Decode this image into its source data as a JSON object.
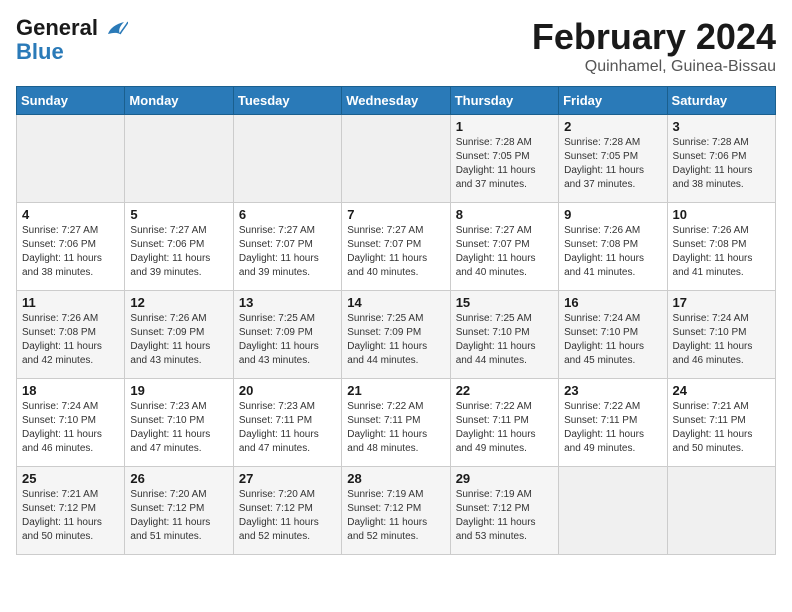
{
  "logo": {
    "line1": "General",
    "line2": "Blue"
  },
  "title": "February 2024",
  "subtitle": "Quinhamel, Guinea-Bissau",
  "weekdays": [
    "Sunday",
    "Monday",
    "Tuesday",
    "Wednesday",
    "Thursday",
    "Friday",
    "Saturday"
  ],
  "weeks": [
    [
      {
        "day": "",
        "info": ""
      },
      {
        "day": "",
        "info": ""
      },
      {
        "day": "",
        "info": ""
      },
      {
        "day": "",
        "info": ""
      },
      {
        "day": "1",
        "info": "Sunrise: 7:28 AM\nSunset: 7:05 PM\nDaylight: 11 hours and 37 minutes."
      },
      {
        "day": "2",
        "info": "Sunrise: 7:28 AM\nSunset: 7:05 PM\nDaylight: 11 hours and 37 minutes."
      },
      {
        "day": "3",
        "info": "Sunrise: 7:28 AM\nSunset: 7:06 PM\nDaylight: 11 hours and 38 minutes."
      }
    ],
    [
      {
        "day": "4",
        "info": "Sunrise: 7:27 AM\nSunset: 7:06 PM\nDaylight: 11 hours and 38 minutes."
      },
      {
        "day": "5",
        "info": "Sunrise: 7:27 AM\nSunset: 7:06 PM\nDaylight: 11 hours and 39 minutes."
      },
      {
        "day": "6",
        "info": "Sunrise: 7:27 AM\nSunset: 7:07 PM\nDaylight: 11 hours and 39 minutes."
      },
      {
        "day": "7",
        "info": "Sunrise: 7:27 AM\nSunset: 7:07 PM\nDaylight: 11 hours and 40 minutes."
      },
      {
        "day": "8",
        "info": "Sunrise: 7:27 AM\nSunset: 7:07 PM\nDaylight: 11 hours and 40 minutes."
      },
      {
        "day": "9",
        "info": "Sunrise: 7:26 AM\nSunset: 7:08 PM\nDaylight: 11 hours and 41 minutes."
      },
      {
        "day": "10",
        "info": "Sunrise: 7:26 AM\nSunset: 7:08 PM\nDaylight: 11 hours and 41 minutes."
      }
    ],
    [
      {
        "day": "11",
        "info": "Sunrise: 7:26 AM\nSunset: 7:08 PM\nDaylight: 11 hours and 42 minutes."
      },
      {
        "day": "12",
        "info": "Sunrise: 7:26 AM\nSunset: 7:09 PM\nDaylight: 11 hours and 43 minutes."
      },
      {
        "day": "13",
        "info": "Sunrise: 7:25 AM\nSunset: 7:09 PM\nDaylight: 11 hours and 43 minutes."
      },
      {
        "day": "14",
        "info": "Sunrise: 7:25 AM\nSunset: 7:09 PM\nDaylight: 11 hours and 44 minutes."
      },
      {
        "day": "15",
        "info": "Sunrise: 7:25 AM\nSunset: 7:10 PM\nDaylight: 11 hours and 44 minutes."
      },
      {
        "day": "16",
        "info": "Sunrise: 7:24 AM\nSunset: 7:10 PM\nDaylight: 11 hours and 45 minutes."
      },
      {
        "day": "17",
        "info": "Sunrise: 7:24 AM\nSunset: 7:10 PM\nDaylight: 11 hours and 46 minutes."
      }
    ],
    [
      {
        "day": "18",
        "info": "Sunrise: 7:24 AM\nSunset: 7:10 PM\nDaylight: 11 hours and 46 minutes."
      },
      {
        "day": "19",
        "info": "Sunrise: 7:23 AM\nSunset: 7:10 PM\nDaylight: 11 hours and 47 minutes."
      },
      {
        "day": "20",
        "info": "Sunrise: 7:23 AM\nSunset: 7:11 PM\nDaylight: 11 hours and 47 minutes."
      },
      {
        "day": "21",
        "info": "Sunrise: 7:22 AM\nSunset: 7:11 PM\nDaylight: 11 hours and 48 minutes."
      },
      {
        "day": "22",
        "info": "Sunrise: 7:22 AM\nSunset: 7:11 PM\nDaylight: 11 hours and 49 minutes."
      },
      {
        "day": "23",
        "info": "Sunrise: 7:22 AM\nSunset: 7:11 PM\nDaylight: 11 hours and 49 minutes."
      },
      {
        "day": "24",
        "info": "Sunrise: 7:21 AM\nSunset: 7:11 PM\nDaylight: 11 hours and 50 minutes."
      }
    ],
    [
      {
        "day": "25",
        "info": "Sunrise: 7:21 AM\nSunset: 7:12 PM\nDaylight: 11 hours and 50 minutes."
      },
      {
        "day": "26",
        "info": "Sunrise: 7:20 AM\nSunset: 7:12 PM\nDaylight: 11 hours and 51 minutes."
      },
      {
        "day": "27",
        "info": "Sunrise: 7:20 AM\nSunset: 7:12 PM\nDaylight: 11 hours and 52 minutes."
      },
      {
        "day": "28",
        "info": "Sunrise: 7:19 AM\nSunset: 7:12 PM\nDaylight: 11 hours and 52 minutes."
      },
      {
        "day": "29",
        "info": "Sunrise: 7:19 AM\nSunset: 7:12 PM\nDaylight: 11 hours and 53 minutes."
      },
      {
        "day": "",
        "info": ""
      },
      {
        "day": "",
        "info": ""
      }
    ]
  ]
}
